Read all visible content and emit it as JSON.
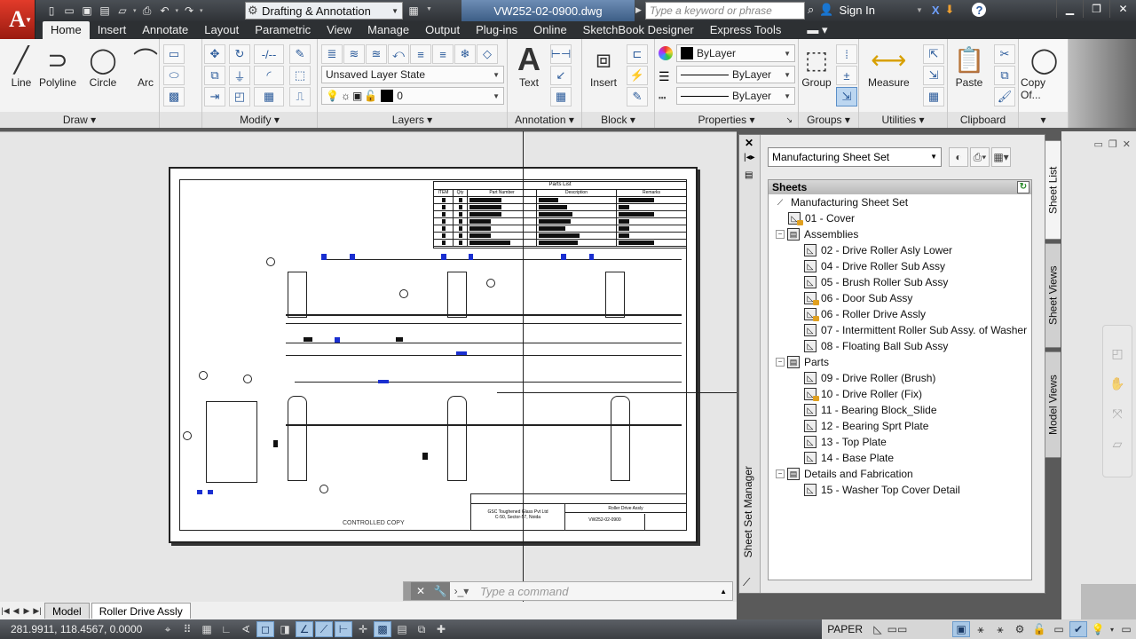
{
  "app": {
    "title_file": "VW252-02-0900.dwg",
    "workspace": "Drafting & Annotation",
    "search_placeholder": "Type a keyword or phrase",
    "sign_in": "Sign In"
  },
  "quick_access": [
    "new-icon",
    "open-icon",
    "save-icon",
    "save-as-icon",
    "publish-icon",
    "plot-icon",
    "undo-icon",
    "redo-icon"
  ],
  "ribbon_tabs": [
    {
      "label": "Home",
      "active": true
    },
    {
      "label": "Insert"
    },
    {
      "label": "Annotate"
    },
    {
      "label": "Layout"
    },
    {
      "label": "Parametric"
    },
    {
      "label": "View"
    },
    {
      "label": "Manage"
    },
    {
      "label": "Output"
    },
    {
      "label": "Plug-ins"
    },
    {
      "label": "Online"
    },
    {
      "label": "SketchBook Designer"
    },
    {
      "label": "Express Tools"
    }
  ],
  "panels": {
    "draw": {
      "title": "Draw",
      "buttons": [
        "Line",
        "Polyline",
        "Circle",
        "Arc"
      ]
    },
    "modify": {
      "title": "Modify"
    },
    "layers": {
      "title": "Layers",
      "layer_state": "Unsaved Layer State",
      "current_layer": "0"
    },
    "annotation": {
      "title": "Annotation",
      "text_label": "Text"
    },
    "block": {
      "title": "Block",
      "insert_label": "Insert"
    },
    "properties": {
      "title": "Properties",
      "color": "ByLayer",
      "lineweight": "ByLayer",
      "linetype": "ByLayer"
    },
    "groups": {
      "title": "Groups",
      "group_label": "Group"
    },
    "utilities": {
      "title": "Utilities",
      "measure_label": "Measure"
    },
    "clipboard": {
      "title": "Clipboard",
      "paste_label": "Paste"
    },
    "extra": {
      "copy_label": "Copy Of..."
    }
  },
  "drawing": {
    "parts_list_title": "Parts List",
    "parts_list_headers": [
      "ITEM",
      "Qty",
      "Part Number",
      "Description",
      "Remarks"
    ],
    "controlled_copy": "CONTROLLED COPY",
    "company_line1": "GSC Toughened Glass Pvt Ltd",
    "company_line2": "C-50, Sector-57, Noida",
    "drawing_title": "Roller Drive Assly",
    "drawing_number": "VW252-02-0900"
  },
  "command_line": {
    "placeholder": "Type a command"
  },
  "layout_tabs": [
    {
      "label": "Model"
    },
    {
      "label": "Roller Drive Assly",
      "active": true
    }
  ],
  "status": {
    "coordinates": "281.9911, 118.4567, 0.0000",
    "space": "PAPER"
  },
  "sheet_set_manager": {
    "title": "Sheet Set Manager",
    "selected_set": "Manufacturing Sheet Set",
    "sheets_header": "Sheets",
    "tabs": [
      "Sheet List",
      "Sheet Views",
      "Model Views"
    ],
    "tree": [
      {
        "label": "Manufacturing Sheet Set",
        "level": 0,
        "type": "root"
      },
      {
        "label": "01 - Cover",
        "level": 1,
        "type": "sheet",
        "locked": true
      },
      {
        "label": "Assemblies",
        "level": 1,
        "type": "group"
      },
      {
        "label": "02 - Drive Roller Asly Lower",
        "level": 2,
        "type": "sheet"
      },
      {
        "label": "04 - Drive Roller Sub Assy",
        "level": 2,
        "type": "sheet"
      },
      {
        "label": "05 - Brush Roller Sub Assy",
        "level": 2,
        "type": "sheet"
      },
      {
        "label": "06 - Door Sub Assy",
        "level": 2,
        "type": "sheet",
        "locked": true
      },
      {
        "label": "06 - Roller Drive Assly",
        "level": 2,
        "type": "sheet",
        "locked": true
      },
      {
        "label": "07 - Intermittent Roller Sub Assy. of Washer",
        "level": 2,
        "type": "sheet"
      },
      {
        "label": "08 - Floating Ball Sub Assy",
        "level": 2,
        "type": "sheet"
      },
      {
        "label": "Parts",
        "level": 1,
        "type": "group"
      },
      {
        "label": "09 - Drive Roller (Brush)",
        "level": 2,
        "type": "sheet"
      },
      {
        "label": "10 - Drive Roller (Fix)",
        "level": 2,
        "type": "sheet",
        "locked": true
      },
      {
        "label": "11 - Bearing Block_Slide",
        "level": 2,
        "type": "sheet"
      },
      {
        "label": "12 - Bearing Sprt Plate",
        "level": 2,
        "type": "sheet"
      },
      {
        "label": "13 - Top Plate",
        "level": 2,
        "type": "sheet"
      },
      {
        "label": "14 - Base Plate",
        "level": 2,
        "type": "sheet"
      },
      {
        "label": "Details and Fabrication",
        "level": 1,
        "type": "group"
      },
      {
        "label": "15 - Washer Top Cover Detail",
        "level": 2,
        "type": "sheet"
      }
    ]
  },
  "colors": {
    "accent": "#1a2fd0",
    "app_red": "#c8281c",
    "title_blue": "#4d6f99"
  }
}
